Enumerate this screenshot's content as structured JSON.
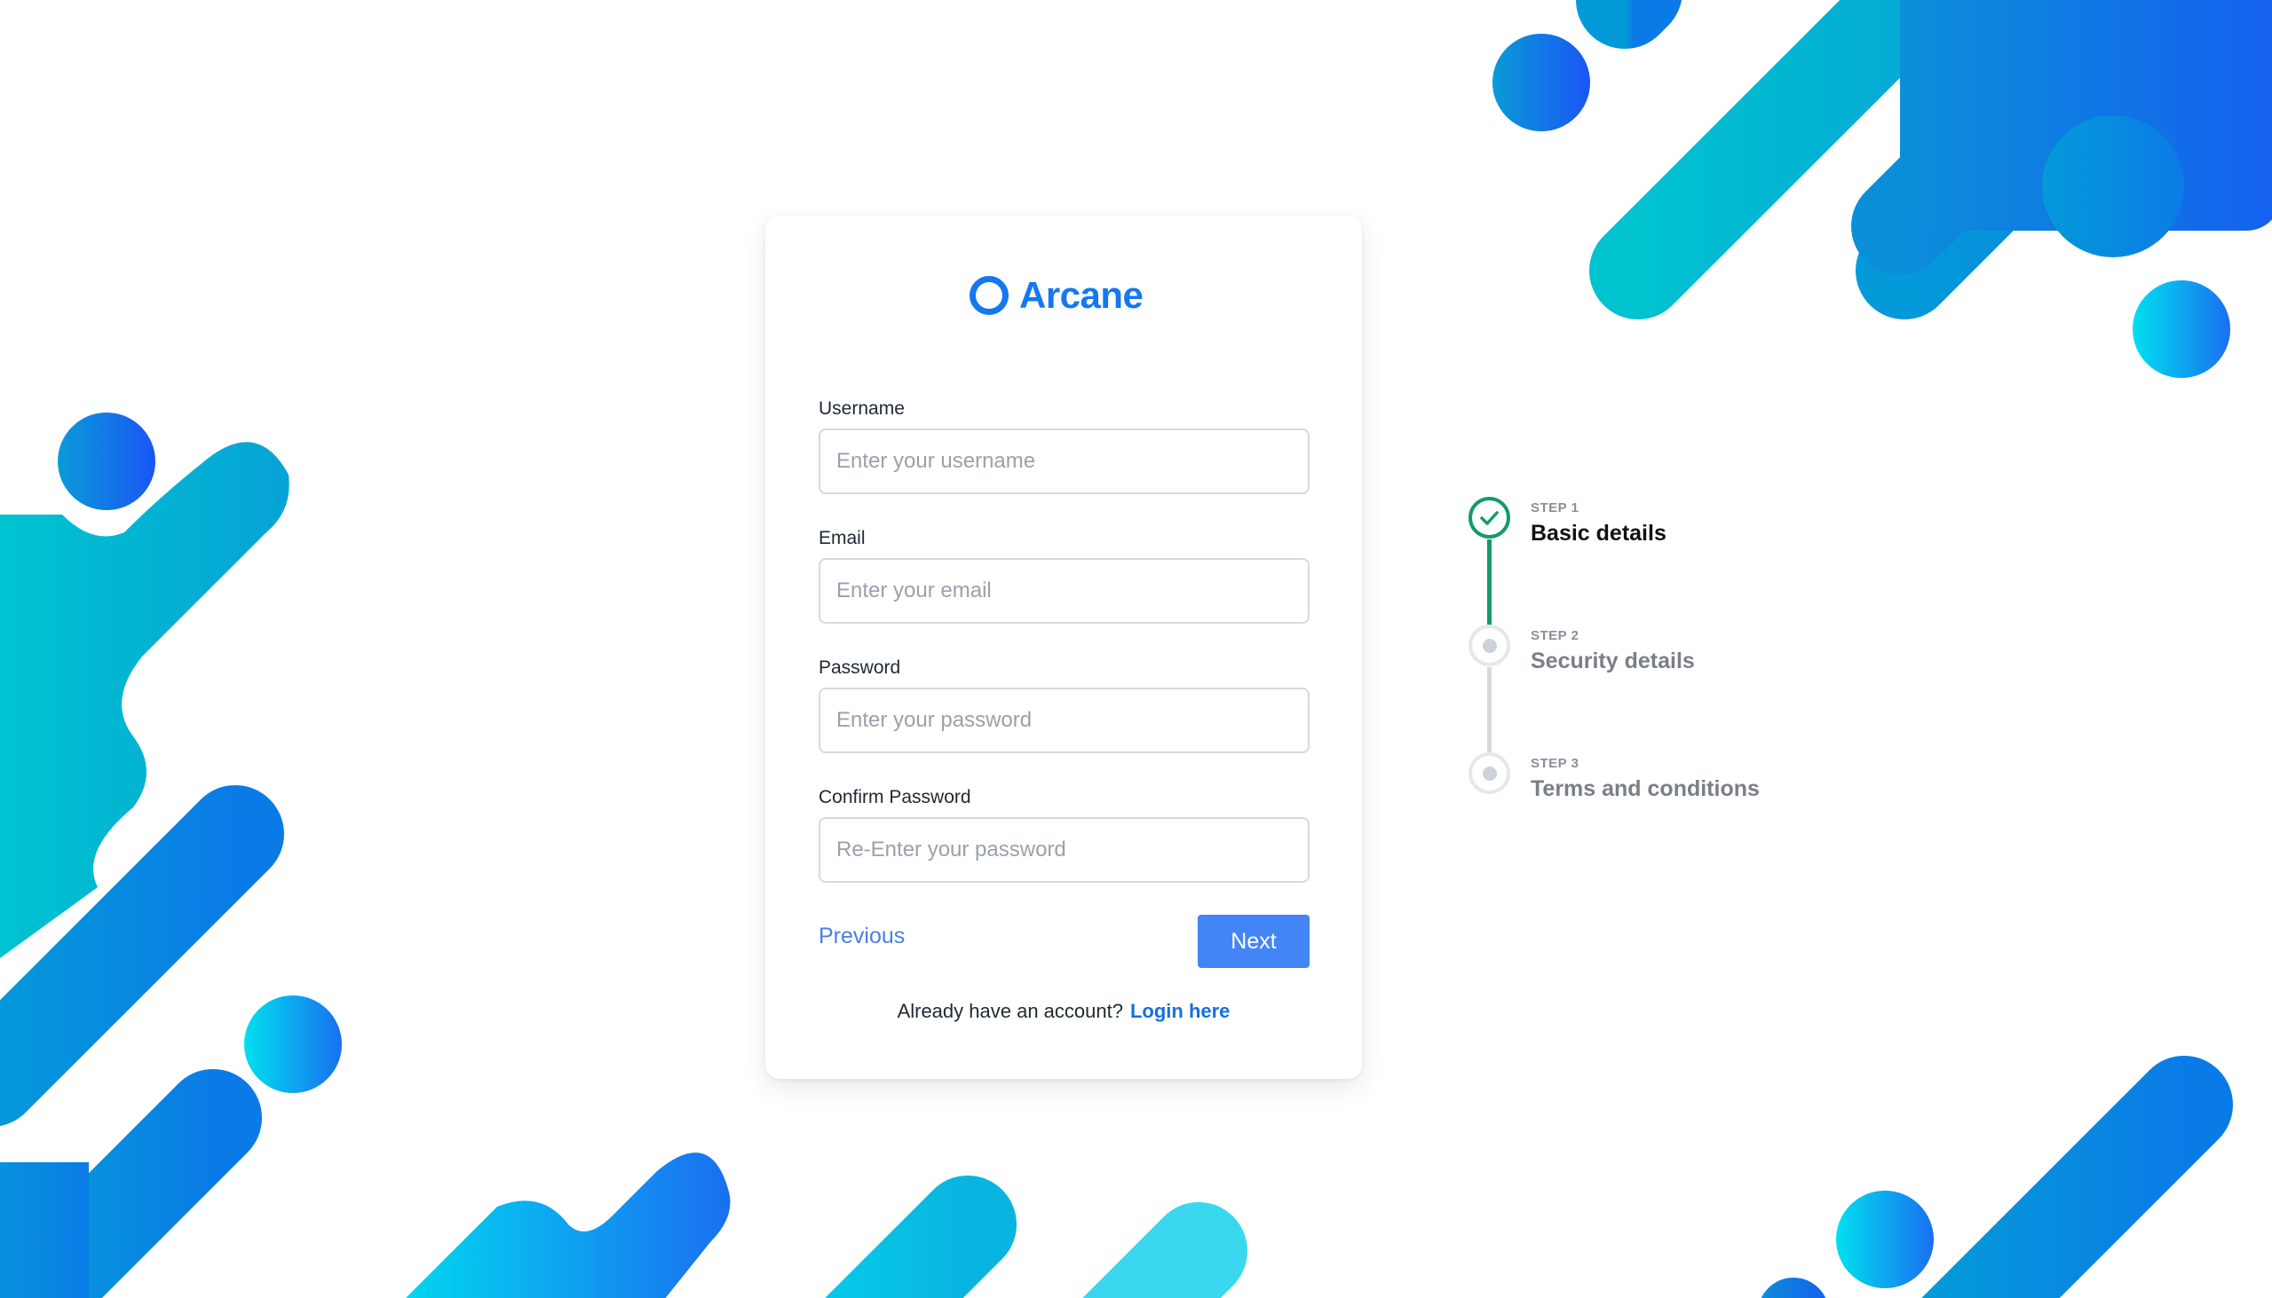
{
  "brand": {
    "name": "Arcane"
  },
  "form": {
    "username": {
      "label": "Username",
      "placeholder": "Enter your username",
      "value": ""
    },
    "email": {
      "label": "Email",
      "placeholder": "Enter your email",
      "value": ""
    },
    "password": {
      "label": "Password",
      "placeholder": "Enter your password",
      "value": ""
    },
    "confirm_password": {
      "label": "Confirm Password",
      "placeholder": "Re-Enter your password",
      "value": ""
    },
    "previous_label": "Previous",
    "next_label": "Next",
    "login_prompt": "Already have an account?",
    "login_link": "Login here"
  },
  "steps": [
    {
      "number": "STEP 1",
      "title": "Basic details",
      "status": "complete"
    },
    {
      "number": "STEP 2",
      "title": "Security details",
      "status": "pending"
    },
    {
      "number": "STEP 3",
      "title": "Terms and conditions",
      "status": "pending"
    }
  ],
  "colors": {
    "brand": "#1478f0",
    "primary_button": "#4385f4",
    "step_complete": "#119c66",
    "step_pending": "#d6dae0"
  },
  "icons": {
    "step_complete": "check-icon",
    "step_pending": "dot-icon"
  }
}
